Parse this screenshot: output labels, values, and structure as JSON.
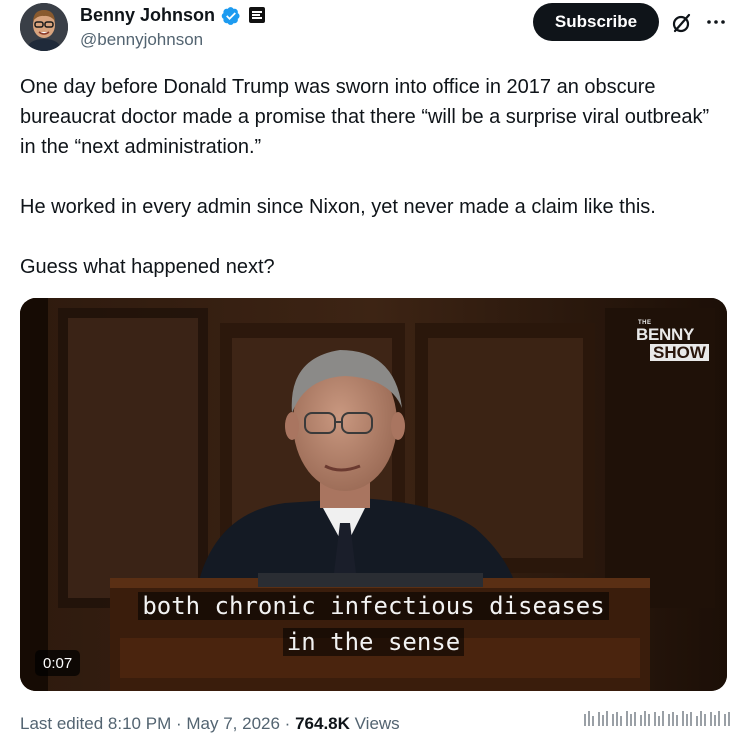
{
  "author": {
    "name": "Benny Johnson",
    "handle": "@bennyjohnson"
  },
  "header": {
    "subscribe_label": "Subscribe"
  },
  "tweet": {
    "paragraphs": [
      "One day before Donald Trump was sworn into office in 2017 an obscure bureaucrat doctor made a promise that there “will be a surprise viral outbreak” in the “next administration.”",
      "He worked in every admin since Nixon, yet never made a claim like this.",
      "Guess what happened next?"
    ]
  },
  "video": {
    "logo_small": "THE",
    "logo_line1": "BENNY",
    "logo_line2": "SHOW",
    "caption_line1": "both chronic infectious diseases",
    "caption_line2": "in the sense",
    "timestamp": "0:07"
  },
  "meta": {
    "edited_label": "Last edited",
    "time": "8:10 PM",
    "date": "May 7, 2026",
    "separator": "·",
    "views_count": "764.8K",
    "views_label": "Views"
  },
  "icons": {
    "verified": "verified-badge-icon",
    "affiliate": "affiliate-badge-icon",
    "grok": "grok-icon",
    "more": "more-options-icon"
  },
  "colors": {
    "verified_blue": "#1d9bf0",
    "text_primary": "#0f1419",
    "text_secondary": "#536471"
  }
}
